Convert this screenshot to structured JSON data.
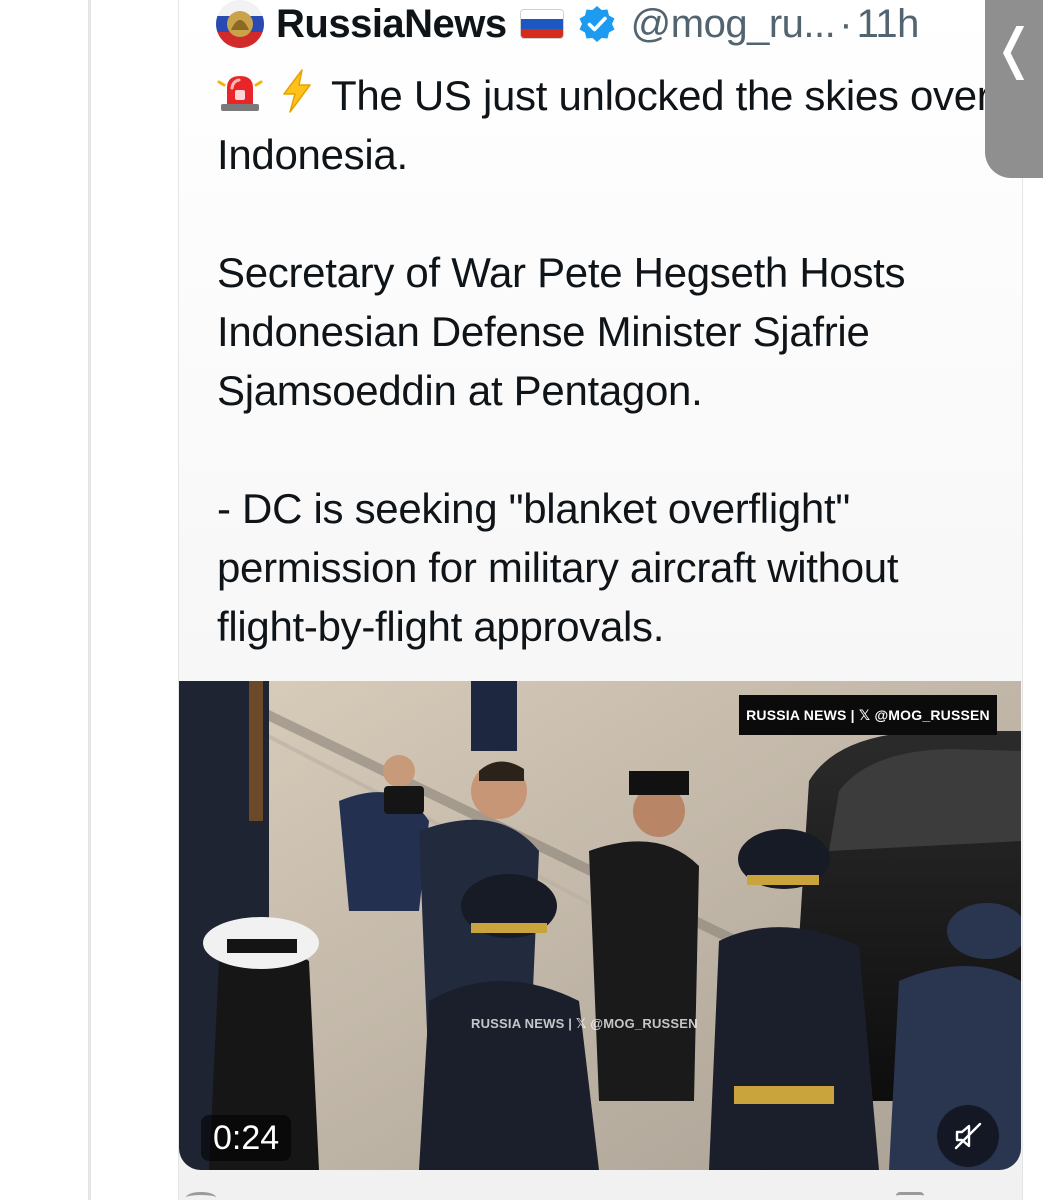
{
  "tweet": {
    "display_name": "RussiaNews",
    "handle": "@mog_ru...",
    "separator": "·",
    "time": "11h",
    "verified": true,
    "flag_icon": "russia-flag",
    "text_line1": "The US just unlocked the skies over Indonesia.",
    "text_line2": "Secretary of War Pete Hegseth Hosts Indonesian Defense Minister Sjafrie Sjamsoeddin at Pentagon.",
    "text_line3": "- DC is seeking \"blanket overflight\" permission for military aircraft without flight-by-flight approvals.",
    "emojis": [
      "police-siren-icon",
      "lightning-icon"
    ]
  },
  "media": {
    "watermark_top": "RUSSIA NEWS | 𝕏 @MOG_RUSSEN",
    "watermark_mid": "RUSSIA NEWS | 𝕏 @MOG_RUSSEN",
    "duration": "0:24",
    "mute_icon": "speaker-muted-icon"
  },
  "side_tab": {
    "label": "❬"
  },
  "colors": {
    "text_primary": "#0f1419",
    "text_secondary": "#536471",
    "verified_blue": "#1d9bf0",
    "side_tab": "#8f8f8f"
  }
}
